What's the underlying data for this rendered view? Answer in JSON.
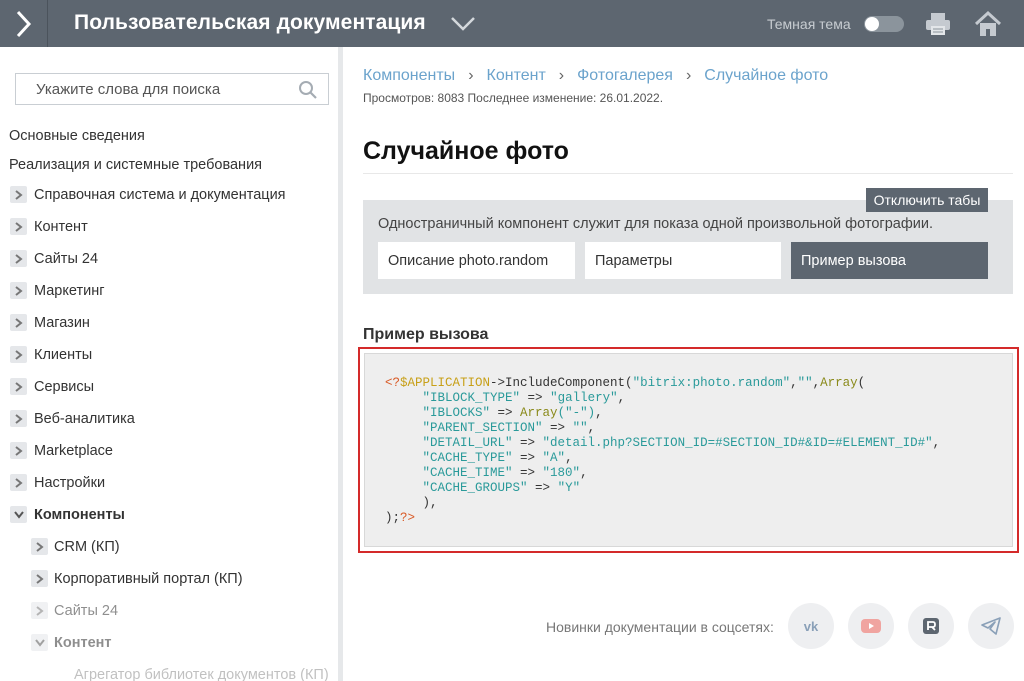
{
  "header": {
    "title": "Пользовательская документация",
    "theme_label": "Темная тема"
  },
  "sidebar": {
    "search_placeholder": "Укажите слова для поиска",
    "plain_items": [
      "Основные сведения",
      "Реализация и системные требования"
    ],
    "items": [
      {
        "label": "Справочная система и документация"
      },
      {
        "label": "Контент"
      },
      {
        "label": "Сайты 24"
      },
      {
        "label": "Маркетинг"
      },
      {
        "label": "Магазин"
      },
      {
        "label": "Клиенты"
      },
      {
        "label": "Сервисы"
      },
      {
        "label": "Веб-аналитика"
      },
      {
        "label": "Marketplace"
      },
      {
        "label": "Настройки"
      },
      {
        "label": "Компоненты"
      }
    ],
    "sub_items": [
      {
        "label": "CRM (КП)"
      },
      {
        "label": "Корпоративный портал (КП)"
      },
      {
        "label": "Сайты 24"
      },
      {
        "label": "Контент"
      }
    ],
    "sub_sub_item": "Агрегатор библиотек документов (КП)"
  },
  "breadcrumb": [
    "Компоненты",
    "Контент",
    "Фотогалерея",
    "Случайное фото"
  ],
  "meta": "Просмотров: 8083 Последнее изменение: 26.01.2022.",
  "page_title": "Случайное фото",
  "disable_tabs_label": "Отключить табы",
  "tab_panel": {
    "description": "Одностраничный компонент служит для показа одной произвольной фотографии.",
    "tabs": [
      "Описание photo.random",
      "Параметры",
      "Пример вызова"
    ],
    "active_tab": "Пример вызова"
  },
  "section_heading": "Пример вызова",
  "code": {
    "l1_open": "<?",
    "l1_var": "$APPLICATION",
    "l1_call": "->IncludeComponent(",
    "l1_s1": "\"bitrix:photo.random\"",
    "l1_comma": ",",
    "l1_s2": "\"\"",
    "l1_comma2": ",",
    "l1_arr": "Array",
    "l1_paren": "(",
    "rows": [
      {
        "k": "\"IBLOCK_TYPE\"",
        "op": " => ",
        "v": "\"gallery\"",
        "end": ","
      },
      {
        "k": "\"IBLOCKS\"",
        "op": " => ",
        "arr": "Array",
        "v": "(\"-\")",
        "end": ","
      },
      {
        "k": "\"PARENT_SECTION\"",
        "op": " => ",
        "v": "\"\"",
        "end": ","
      },
      {
        "k": "\"DETAIL_URL\"",
        "op": " => ",
        "v": "\"detail.php?SECTION_ID=#SECTION_ID#&ID=#ELEMENT_ID#\"",
        "end": ","
      },
      {
        "k": "\"CACHE_TYPE\"",
        "op": " => ",
        "v": "\"A\"",
        "end": ","
      },
      {
        "k": "\"CACHE_TIME\"",
        "op": " => ",
        "v": "\"180\"",
        "end": ","
      },
      {
        "k": "\"CACHE_GROUPS\"",
        "op": " => ",
        "v": "\"Y\"",
        "end": ""
      }
    ],
    "close_inner": "),",
    "close_outer": ");",
    "close_tag": "?>"
  },
  "social": {
    "label": "Новинки документации в соцсетях:",
    "icons": [
      "vk-icon",
      "youtube-icon",
      "rutube-icon",
      "telegram-icon"
    ]
  },
  "colors": {
    "header_bg": "#5d6670",
    "link": "#6ba3cc",
    "highlight_border": "#d42a2a"
  }
}
